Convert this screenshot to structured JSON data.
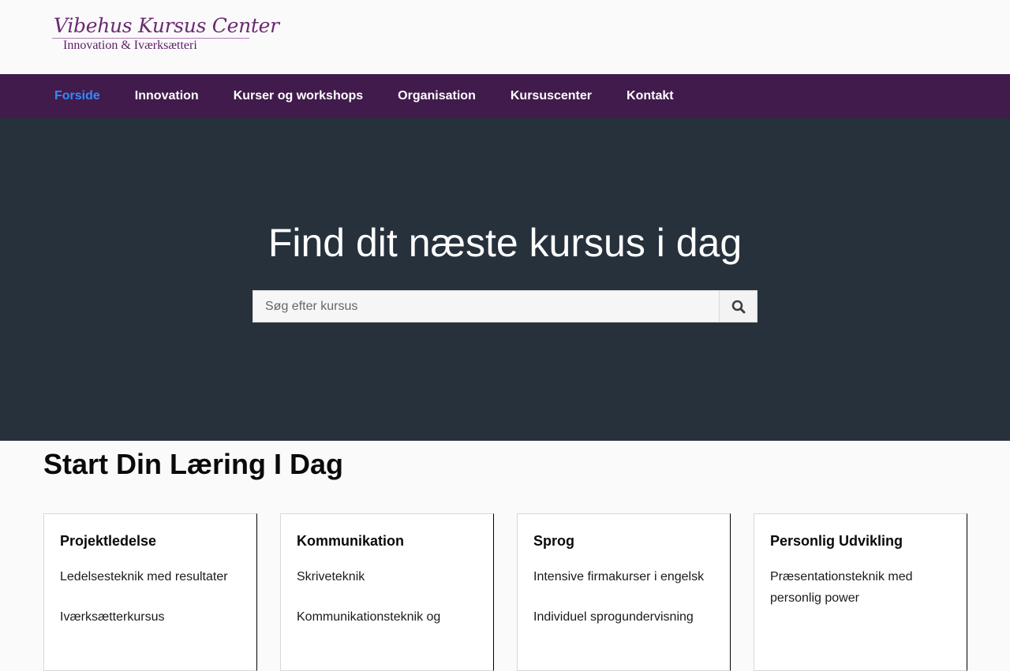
{
  "logo": {
    "title": "Vibehus Kursus Center",
    "subtitle": "Innovation & Iværksætteri"
  },
  "nav": {
    "items": [
      {
        "label": "Forside",
        "active": true
      },
      {
        "label": "Innovation",
        "active": false
      },
      {
        "label": "Kurser og workshops",
        "active": false
      },
      {
        "label": "Organisation",
        "active": false
      },
      {
        "label": "Kursuscenter",
        "active": false
      },
      {
        "label": "Kontakt",
        "active": false
      }
    ]
  },
  "hero": {
    "title": "Find dit næste kursus i dag",
    "search_placeholder": "Søg efter kursus",
    "search_icon": "search-icon"
  },
  "section": {
    "title": "Start Din Læring I Dag"
  },
  "cards": [
    {
      "title": "Projektledelse",
      "links": [
        "Ledelsesteknik med resultater",
        "Iværksætterkursus"
      ]
    },
    {
      "title": "Kommunikation",
      "links": [
        "Skriveteknik",
        "Kommunikationsteknik og"
      ]
    },
    {
      "title": "Sprog",
      "links": [
        "Intensive firmakurser i engelsk",
        "Individuel sprogundervisning"
      ]
    },
    {
      "title": "Personlig Udvikling",
      "links": [
        "Præsentationsteknik med personlig power"
      ]
    }
  ],
  "colors": {
    "nav_bg": "#411b4c",
    "nav_active": "#2f8cff",
    "hero_bg": "#27313c",
    "logo_purple": "#6b2a73"
  }
}
